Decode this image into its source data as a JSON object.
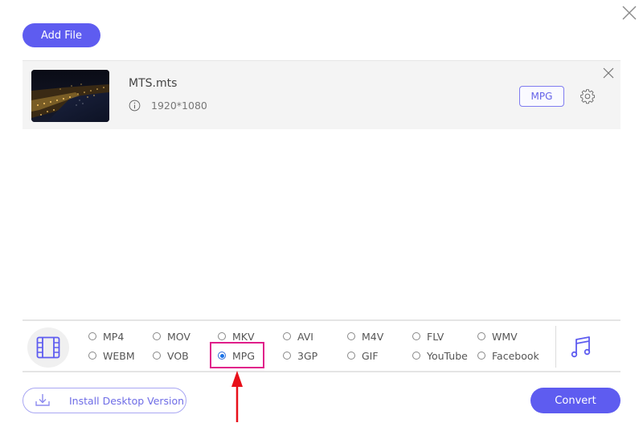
{
  "window": {
    "close_icon": "close-icon"
  },
  "toolbar": {
    "add_file_label": "Add File"
  },
  "file": {
    "name": "MTS.mts",
    "resolution": "1920*1080",
    "info_icon": "info-circle-icon",
    "output_format": "MPG",
    "settings_icon": "gear-icon",
    "remove_icon": "close-icon",
    "thumbnail": "night-city-harbor-thumbnail"
  },
  "formats": {
    "category_icon": "film-icon",
    "audio_icon": "music-note-icon",
    "selected": "MPG",
    "row1": [
      "MP4",
      "MOV",
      "MKV",
      "AVI",
      "M4V",
      "FLV",
      "WMV"
    ],
    "row2": [
      "WEBM",
      "VOB",
      "MPG",
      "3GP",
      "GIF",
      "YouTube",
      "Facebook"
    ]
  },
  "footer": {
    "install_label": "Install Desktop Version",
    "install_icon": "download-icon",
    "convert_label": "Convert"
  },
  "colors": {
    "accent": "#5e5cf0",
    "highlight": "#e01e8a",
    "arrow": "#e8101a",
    "radio_selected": "#1a73e8"
  }
}
